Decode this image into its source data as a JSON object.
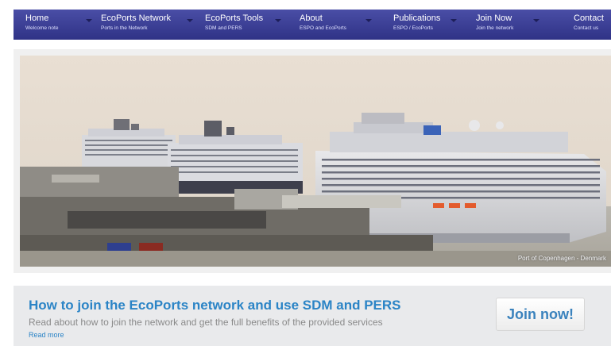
{
  "nav": {
    "items": [
      {
        "title": "Home",
        "subtitle": "Welcome note"
      },
      {
        "title": "EcoPorts Network",
        "subtitle": "Ports in the Network"
      },
      {
        "title": "EcoPorts Tools",
        "subtitle": "SDM and PERS"
      },
      {
        "title": "About",
        "subtitle": "ESPO and EcoPorts"
      },
      {
        "title": "Publications",
        "subtitle": "ESPO / EcoPorts"
      },
      {
        "title": "Join Now",
        "subtitle": "Join the network"
      },
      {
        "title": "Contact",
        "subtitle": "Contact us"
      }
    ],
    "color_bar": "#3a3d98"
  },
  "hero": {
    "caption": "Port of Copenhagen - Denmark"
  },
  "banner": {
    "title": "How to join the EcoPorts network and use SDM and PERS",
    "text": "Read about how to join the network and get the full benefits of the provided services",
    "read_more": "Read more",
    "join_button": "Join now!",
    "accent": "#2b84c6"
  }
}
